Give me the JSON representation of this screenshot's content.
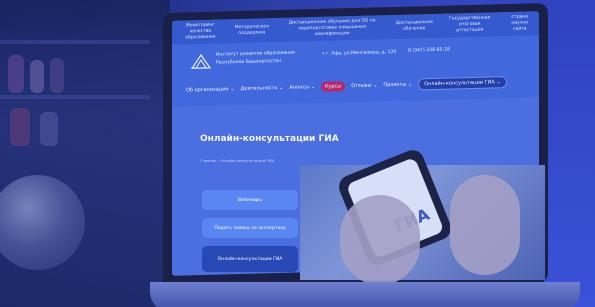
{
  "top_nav": [
    "Мониторинг качества образования",
    "Методическая поддержка",
    "Дистанционное обучение для ПО по переподготовке повышения квалификации",
    "Дистанционное обучение",
    "Государственная итоговая аттестация",
    "страна научно сайта"
  ],
  "brand": {
    "line1": "Институт развития образования",
    "line2": "Республики Башкортостан"
  },
  "address": "г. Уфа, ул.Мингажева, д. 120",
  "phone": "8 (347) 228-85-18",
  "menu": [
    {
      "label": "Об организации ⌄",
      "style": "plain"
    },
    {
      "label": "Деятельность ⌄",
      "style": "plain"
    },
    {
      "label": "Анонсы ⌄",
      "style": "plain"
    },
    {
      "label": "Курсы",
      "style": "red"
    },
    {
      "label": "Отзывы ⌄",
      "style": "plain"
    },
    {
      "label": "Проекты ⌄",
      "style": "plain"
    },
    {
      "label": "Онлайн-консультации ГИА ⌄",
      "style": "dark"
    }
  ],
  "page_title": "Онлайн-консультации ГИА",
  "breadcrumb": "Главная  ›  Онлайн-консультации ГИА",
  "side_buttons": [
    "Вебинары",
    "Подать заявку на экспертизу",
    "Онлайн-консультации ГИА"
  ],
  "phone_screen_text": "ГИА",
  "colors": {
    "accent": "#4169dd",
    "nav": "#3559cf",
    "pill_red": "#b6286a"
  }
}
